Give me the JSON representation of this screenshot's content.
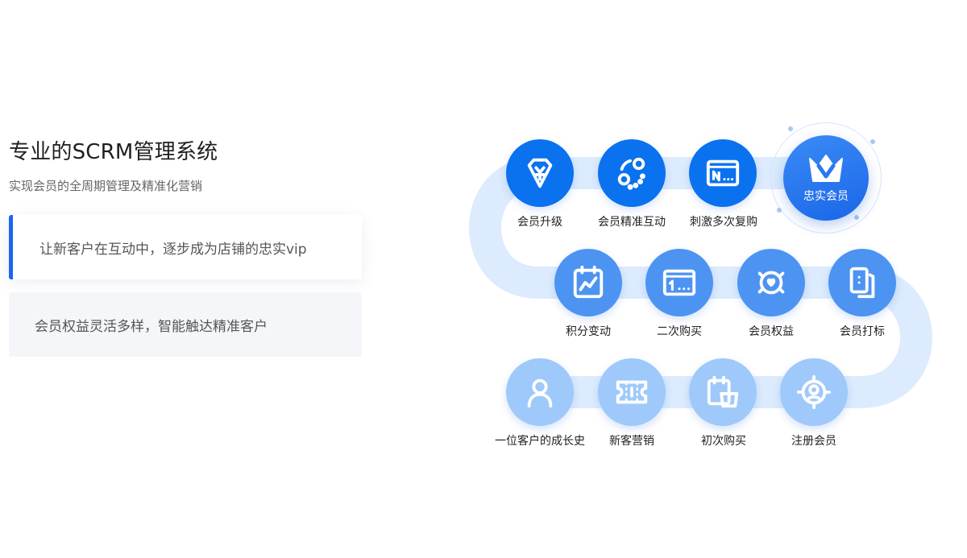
{
  "header": {
    "title": "专业的SCRM管理系统",
    "subtitle": "实现会员的全周期管理及精准化营销"
  },
  "features": [
    {
      "text": "让新客户在互动中，逐步成为店铺的忠实vip",
      "active": true
    },
    {
      "text": "会员权益灵活多样，智能触达精准客户",
      "active": false
    }
  ],
  "journey": {
    "row1": [
      {
        "label": "会员升级",
        "icon": "diamond-yen-icon"
      },
      {
        "label": "会员精准互动",
        "icon": "interaction-icon"
      },
      {
        "label": "刺激多次复购",
        "icon": "card-n-icon"
      }
    ],
    "loyal": {
      "label": "忠实会员",
      "icon": "crown-v-icon"
    },
    "row2": [
      {
        "label": "积分变动",
        "icon": "chart-calendar-icon"
      },
      {
        "label": "二次购买",
        "icon": "card-one-icon"
      },
      {
        "label": "会员权益",
        "icon": "heart-badge-icon"
      },
      {
        "label": "会员打标",
        "icon": "tag-cards-icon"
      }
    ],
    "row3": [
      {
        "label": "一位客户的成长史",
        "icon": "user-icon"
      },
      {
        "label": "新客营销",
        "icon": "ticket-icon"
      },
      {
        "label": "初次购买",
        "icon": "calendar-cart-icon"
      },
      {
        "label": "注册会员",
        "icon": "user-circle-icon"
      }
    ],
    "colors": {
      "dark": "#0a72ef",
      "mid": "#4d94f2",
      "light": "#9fc9fa",
      "track": "#dcebfd"
    }
  }
}
